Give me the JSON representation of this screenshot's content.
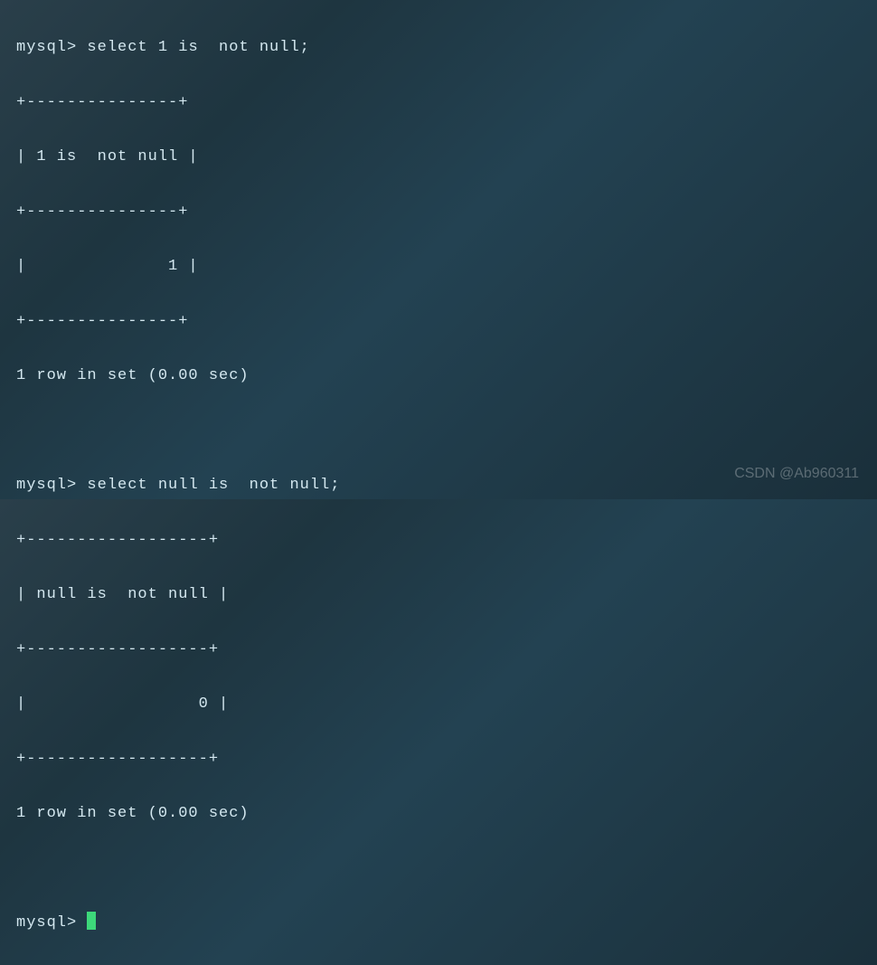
{
  "prompt": "mysql>",
  "query1": {
    "command": "select 1 is  not null;",
    "border_top": "+---------------+",
    "header": "| 1 is  not null |",
    "border_mid": "+---------------+",
    "value_row": "|              1 |",
    "border_bot": "+---------------+",
    "status": "1 row in set (0.00 sec)"
  },
  "query2": {
    "command": "select null is  not null;",
    "border_top": "+------------------+",
    "header": "| null is  not null |",
    "border_mid": "+------------------+",
    "value_row": "|                 0 |",
    "border_bot": "+------------------+",
    "status": "1 row in set (0.00 sec)"
  },
  "watermark": "CSDN @Ab960311"
}
